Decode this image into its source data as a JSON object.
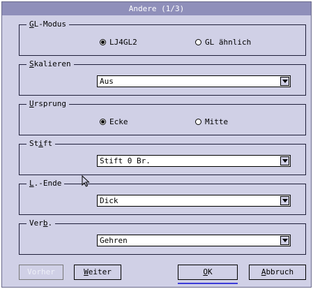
{
  "dialog": {
    "title": "Andere (1/3)"
  },
  "gl_mode": {
    "legend_underlined": "G",
    "legend_rest": "L-Modus",
    "options": [
      {
        "label": "LJ4GL2",
        "selected": true
      },
      {
        "label": "GL ähnlich",
        "selected": false
      }
    ]
  },
  "scaling": {
    "legend_underlined": "S",
    "legend_rest": "kalieren",
    "value": "Aus"
  },
  "origin": {
    "legend_underlined": "U",
    "legend_rest": "rsprung",
    "options": [
      {
        "label": "Ecke",
        "selected": true
      },
      {
        "label": "Mitte",
        "selected": false
      }
    ]
  },
  "pen": {
    "legend_pre": "St",
    "legend_underlined": "i",
    "legend_rest": "ft",
    "value": "Stift 0 Br."
  },
  "line_end": {
    "legend_underlined": "L",
    "legend_rest": ".-Ende",
    "value": "Dick"
  },
  "join": {
    "legend_pre": "Ver",
    "legend_underlined": "b",
    "legend_rest": ".",
    "value": "Gehren"
  },
  "buttons": {
    "back": "Vorher",
    "next_underlined": "W",
    "next_rest": "eiter",
    "ok_underlined": "O",
    "ok_rest": "K",
    "cancel_underlined": "A",
    "cancel_rest": "bbruch"
  },
  "icons": {
    "cursor": "mouse-pointer-icon",
    "dropdown": "chevron-down-icon",
    "radio": "radio-button-icon"
  },
  "colors": {
    "dialog_bg": "#d0d0e6",
    "titlebar_bg": "#8f8fba",
    "focus_underline": "#3c3cd8"
  }
}
